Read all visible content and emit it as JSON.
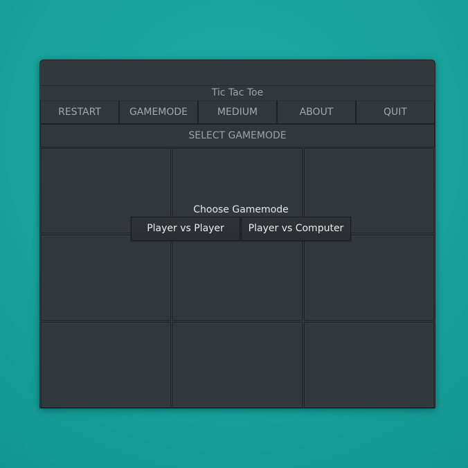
{
  "window": {
    "app_title": "Tic Tac Toe"
  },
  "menu": {
    "restart": "RESTART",
    "gamemode": "GAMEMODE",
    "difficulty": "MEDIUM",
    "about": "ABOUT",
    "quit": "QUIT"
  },
  "status": {
    "text": "SELECT GAMEMODE"
  },
  "board": {
    "cells": [
      "",
      "",
      "",
      "",
      "",
      "",
      "",
      "",
      ""
    ]
  },
  "dialog": {
    "title": "Choose Gamemode",
    "pvp_label": "Player vs Player",
    "pvc_label": "Player vs Computer"
  },
  "colors": {
    "desktop": "#17a29c",
    "window_bg": "#32373b",
    "border": "#1f2225"
  }
}
